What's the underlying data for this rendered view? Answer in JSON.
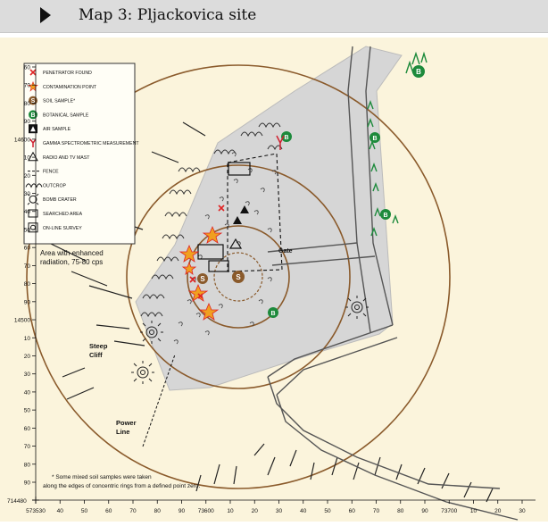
{
  "header": {
    "title": "Map 3: Pljackovica site",
    "icon": "chevron-right-icon"
  },
  "legend": {
    "items": [
      {
        "icon": "penetrator-x-icon",
        "label": "PENETRATOR FOUND",
        "color": "#e02424"
      },
      {
        "icon": "star-icon",
        "label": "CONTAMINATION POINT",
        "color": "#f0a020"
      },
      {
        "icon": "soil-s-icon",
        "label": "SOIL SAMPLE*",
        "color": "#8a5a2b"
      },
      {
        "icon": "botanical-b-icon",
        "label": "BOTANICAL SAMPLE",
        "color": "#1d8a3c"
      },
      {
        "icon": "air-triangle-icon",
        "label": "AIR SAMPLE",
        "color": "#111111"
      },
      {
        "icon": "gamma-y-icon",
        "label": "GAMMA SPECTROMETRIC MEASUREMENT",
        "color": "#d02030"
      },
      {
        "icon": "mast-triangle-icon",
        "label": "RADIO AND TV MAST",
        "color": "#111111"
      },
      {
        "icon": "fence-dash-icon",
        "label": "FENCE",
        "color": "#111111"
      },
      {
        "icon": "outcrop-icon",
        "label": "OUTCROP",
        "color": "#111111"
      },
      {
        "icon": "bomb-crater-icon",
        "label": "BOMB CRATER",
        "color": "#111111"
      },
      {
        "icon": "searched-square-icon",
        "label": "SEARCHED AREA",
        "color": "#111111"
      },
      {
        "icon": "online-survey-icon",
        "label": "ON-LINE SURVEY",
        "color": "#111111"
      }
    ]
  },
  "labels": {
    "enhanced_line1": "Area with enhanced",
    "enhanced_line2": "radiation, 75-80 cps",
    "gate": "Gate",
    "steep_cliff_1": "Steep",
    "steep_cliff_2": "Cliff",
    "power_line_1": "Power",
    "power_line_2": "Line",
    "footnote_line1": "* Some mixed soil samples were taken",
    "footnote_line2": "along the edges of concentric rings from a defined point zero."
  },
  "axes": {
    "y_ticks": [
      "60",
      "70",
      "80",
      "90",
      "14600",
      "10",
      "20",
      "30",
      "40",
      "50",
      "60",
      "70",
      "80",
      "90",
      "14500",
      "10",
      "20",
      "30",
      "40",
      "50",
      "60",
      "70",
      "80",
      "90"
    ],
    "x_ticks": [
      "573530",
      "40",
      "50",
      "60",
      "70",
      "80",
      "90",
      "73600",
      "10",
      "20",
      "30",
      "40",
      "50",
      "60",
      "70",
      "80",
      "90",
      "73700",
      "10",
      "20",
      "30"
    ],
    "origin_label": "714480"
  },
  "colors": {
    "background": "#fbf4dc",
    "area": "#d6d6d6",
    "rings": "#8a5a2b",
    "roads": "#555555"
  }
}
